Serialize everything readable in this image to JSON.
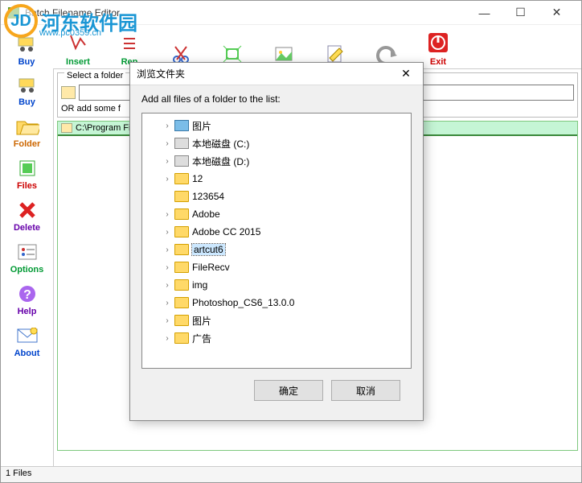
{
  "window": {
    "title": "Batch Filename Editor"
  },
  "watermark": {
    "text": "河东软件园",
    "url": "www.pc0359.cn"
  },
  "toolbar": {
    "buy": "Buy",
    "insert": "Insert",
    "replace": "Rep",
    "cut": "",
    "tag": "",
    "pic": "",
    "edit": "",
    "undo": "",
    "exit": "Exit"
  },
  "sidebar": {
    "buy": "Buy",
    "folder": "Folder",
    "files": "Files",
    "delete": "Delete",
    "options": "Options",
    "help": "Help",
    "about": "About"
  },
  "work": {
    "select_label": "Select a folder",
    "or_label": "OR add some f",
    "path": "C:\\Program File"
  },
  "dialog": {
    "title": "浏览文件夹",
    "message": "Add all files of a folder to the list:",
    "ok": "确定",
    "cancel": "取消",
    "tree": [
      {
        "name": "图片",
        "type": "pic",
        "expand": true
      },
      {
        "name": "本地磁盘 (C:)",
        "type": "drive",
        "expand": true
      },
      {
        "name": "本地磁盘 (D:)",
        "type": "drive",
        "expand": true
      },
      {
        "name": "12",
        "type": "folder",
        "expand": true
      },
      {
        "name": "123654",
        "type": "folder",
        "expand": false
      },
      {
        "name": "Adobe",
        "type": "folder",
        "expand": true
      },
      {
        "name": "Adobe CC 2015",
        "type": "folder",
        "expand": true
      },
      {
        "name": "artcut6",
        "type": "folder",
        "expand": true,
        "selected": true
      },
      {
        "name": "FileRecv",
        "type": "folder",
        "expand": true
      },
      {
        "name": "img",
        "type": "folder",
        "expand": true
      },
      {
        "name": "Photoshop_CS6_13.0.0",
        "type": "folder",
        "expand": true
      },
      {
        "name": "图片",
        "type": "folder",
        "expand": true
      },
      {
        "name": "广告",
        "type": "folder",
        "expand": true
      }
    ]
  },
  "status": {
    "text": "1 Files"
  }
}
